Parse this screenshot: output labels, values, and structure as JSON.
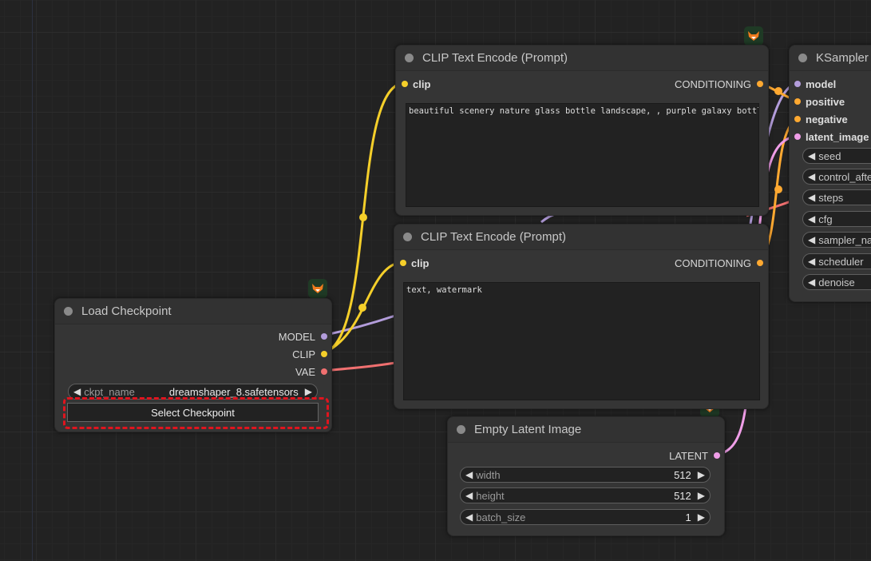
{
  "colors": {
    "clip": "#f5cf2a",
    "model": "#b39ddb",
    "vae": "#f07070",
    "conditioning": "#ffa931",
    "latent": "#f09ee8"
  },
  "icons": {
    "badge": "fox-icon"
  },
  "load_checkpoint": {
    "title": "Load Checkpoint",
    "outputs": [
      "MODEL",
      "CLIP",
      "VAE"
    ],
    "ckpt_label": "ckpt_name",
    "ckpt_value": "dreamshaper_8.safetensors",
    "select_button": "Select Checkpoint"
  },
  "clip_positive": {
    "title": "CLIP Text Encode (Prompt)",
    "input": "clip",
    "output": "CONDITIONING",
    "text": "beautiful scenery nature glass bottle landscape, , purple galaxy bottle,"
  },
  "clip_negative": {
    "title": "CLIP Text Encode (Prompt)",
    "input": "clip",
    "output": "CONDITIONING",
    "text": "text, watermark"
  },
  "empty_latent": {
    "title": "Empty Latent Image",
    "output": "LATENT",
    "widgets": [
      {
        "label": "width",
        "value": "512"
      },
      {
        "label": "height",
        "value": "512"
      },
      {
        "label": "batch_size",
        "value": "1"
      }
    ]
  },
  "ksampler": {
    "title": "KSampler",
    "inputs": [
      "model",
      "positive",
      "negative",
      "latent_image"
    ],
    "widgets": [
      "seed",
      "control_after",
      "steps",
      "cfg",
      "sampler_na",
      "scheduler",
      "denoise"
    ]
  }
}
